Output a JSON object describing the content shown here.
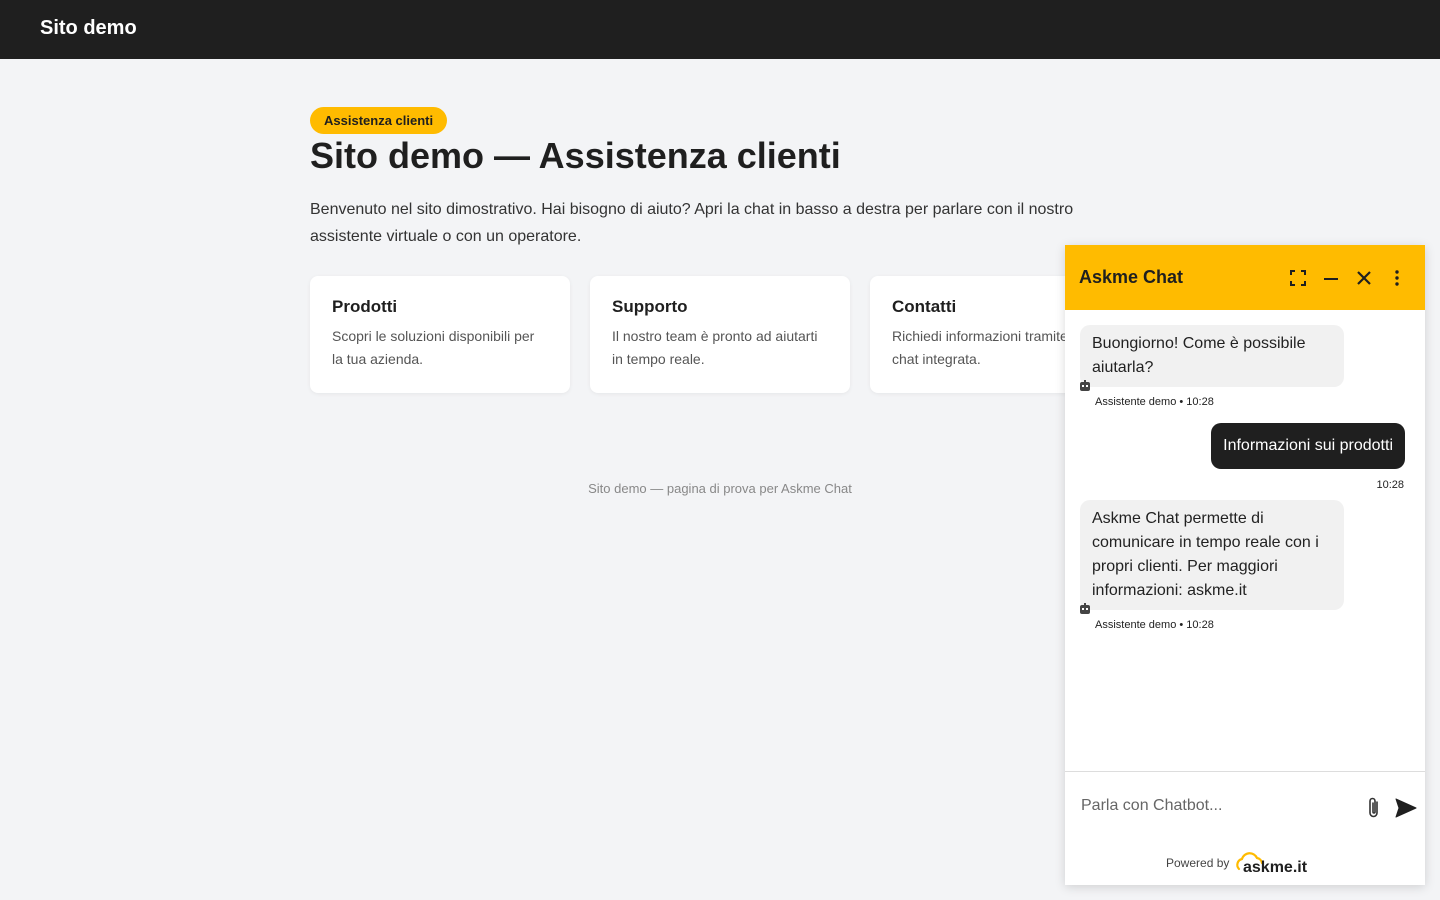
{
  "topbar": {
    "brand": "Sito demo"
  },
  "main": {
    "badge": "Assistenza clienti",
    "title": "Sito demo — Assistenza clienti",
    "intro": "Benvenuto nel sito dimostrativo. Hai bisogno di aiuto? Apri la chat in basso a destra per parlare con il nostro assistente virtuale o con un operatore."
  },
  "cards": [
    {
      "title": "Prodotti",
      "text": "Scopri le soluzioni disponibili per la tua azienda."
    },
    {
      "title": "Supporto",
      "text": "Il nostro team è pronto ad aiutarti in tempo reale."
    },
    {
      "title": "Contatti",
      "text": "Richiedi informazioni tramite la chat integrata."
    }
  ],
  "footer": {
    "text": "Sito demo — pagina di prova per Askme Chat"
  },
  "chat": {
    "title": "Askme Chat",
    "messages": [
      {
        "from": "bot",
        "text": "Buongiorno! Come è possibile aiutarla?",
        "meta": "Assistente demo • 10:28"
      },
      {
        "from": "user",
        "text": "Informazioni sui prodotti",
        "meta": "10:28"
      },
      {
        "from": "bot",
        "text": "Askme Chat permette di comunicare in tempo reale con i propri clienti. Per maggiori informazioni: askme.it",
        "meta": "Assistente demo • 10:28"
      }
    ],
    "input_placeholder": "Parla con Chatbot...",
    "powered_by": "Powered by",
    "brand_logo_text": "askme.it"
  },
  "colors": {
    "accent": "#ffbb00",
    "dark": "#1f1f1f",
    "page_bg": "#f3f4f6"
  }
}
